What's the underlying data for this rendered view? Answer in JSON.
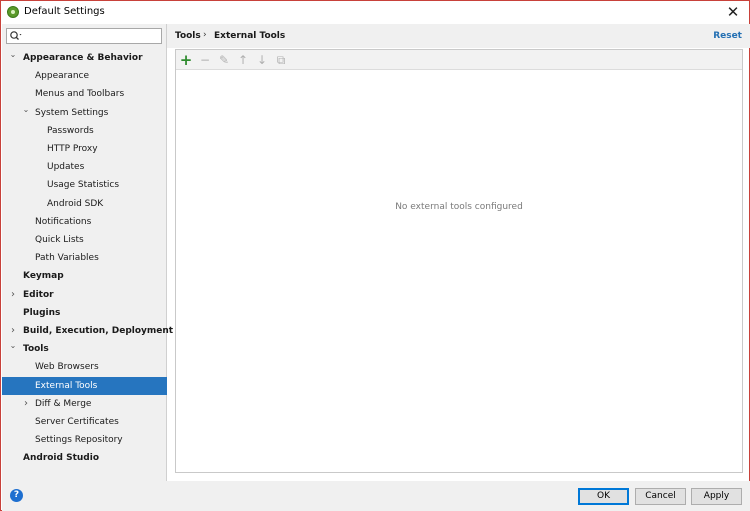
{
  "window": {
    "title": "Default Settings",
    "close_glyph": "✕"
  },
  "search": {
    "placeholder": "",
    "value": ""
  },
  "tree": [
    {
      "label": "Appearance & Behavior",
      "level": 0,
      "bold": true,
      "arrow": "expanded"
    },
    {
      "label": "Appearance",
      "level": 1
    },
    {
      "label": "Menus and Toolbars",
      "level": 1
    },
    {
      "label": "System Settings",
      "level": 1,
      "arrow": "expanded"
    },
    {
      "label": "Passwords",
      "level": 2
    },
    {
      "label": "HTTP Proxy",
      "level": 2
    },
    {
      "label": "Updates",
      "level": 2
    },
    {
      "label": "Usage Statistics",
      "level": 2
    },
    {
      "label": "Android SDK",
      "level": 2
    },
    {
      "label": "Notifications",
      "level": 1
    },
    {
      "label": "Quick Lists",
      "level": 1
    },
    {
      "label": "Path Variables",
      "level": 1
    },
    {
      "label": "Keymap",
      "level": 0,
      "bold": true
    },
    {
      "label": "Editor",
      "level": 0,
      "bold": true,
      "arrow": "collapsed"
    },
    {
      "label": "Plugins",
      "level": 0,
      "bold": true
    },
    {
      "label": "Build, Execution, Deployment",
      "level": 0,
      "bold": true,
      "arrow": "collapsed"
    },
    {
      "label": "Tools",
      "level": 0,
      "bold": true,
      "arrow": "expanded"
    },
    {
      "label": "Web Browsers",
      "level": 1
    },
    {
      "label": "External Tools",
      "level": 1,
      "selected": true
    },
    {
      "label": "Diff & Merge",
      "level": 1,
      "arrow": "collapsed"
    },
    {
      "label": "Server Certificates",
      "level": 1
    },
    {
      "label": "Settings Repository",
      "level": 1
    },
    {
      "label": "Android Studio",
      "level": 0,
      "bold": true
    }
  ],
  "breadcrumb": {
    "parent": "Tools",
    "separator": "›",
    "current": "External Tools"
  },
  "header": {
    "reset_label": "Reset"
  },
  "toolbar": {
    "buttons": [
      {
        "name": "add-icon",
        "glyph": "+",
        "color": "#2e8b2e",
        "enabled": true
      },
      {
        "name": "remove-icon",
        "glyph": "−",
        "color": "#b0b0b0",
        "enabled": false
      },
      {
        "name": "edit-icon",
        "glyph": "✎",
        "color": "#b0b0b0",
        "enabled": false
      },
      {
        "name": "move-up-icon",
        "glyph": "↑",
        "color": "#b0b0b0",
        "enabled": false
      },
      {
        "name": "move-down-icon",
        "glyph": "↓",
        "color": "#b0b0b0",
        "enabled": false
      },
      {
        "name": "copy-icon",
        "glyph": "⧉",
        "color": "#b0b0b0",
        "enabled": false
      }
    ]
  },
  "panel": {
    "empty_text": "No external tools configured"
  },
  "footer": {
    "help_glyph": "?",
    "ok_label": "OK",
    "cancel_label": "Cancel",
    "apply_label": "Apply"
  },
  "colors": {
    "selection": "#2675bf",
    "link": "#2470b3",
    "accent_border": "#c8413a"
  }
}
